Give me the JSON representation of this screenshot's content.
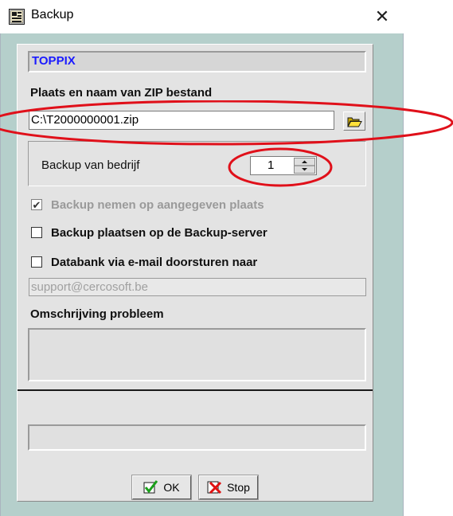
{
  "window": {
    "title": "Backup"
  },
  "company": "TOPPIX",
  "zip": {
    "label": "Plaats en naam van ZIP bestand",
    "value": "C:\\T2000000001.zip"
  },
  "bedrijf": {
    "label": "Backup van bedrijf",
    "value": "1"
  },
  "options": {
    "local": {
      "label": "Backup nemen op aangegeven plaats",
      "checked": true,
      "disabled": true
    },
    "server": {
      "label": "Backup plaatsen op de Backup-server",
      "checked": false
    },
    "email": {
      "label": "Databank via e-mail doorsturen naar",
      "checked": false
    }
  },
  "email_value": "support@cercosoft.be",
  "omschrijving_label": "Omschrijving probleem",
  "buttons": {
    "ok": "OK",
    "stop": "Stop"
  },
  "colors": {
    "dialog_bg": "#b5cfcb",
    "panel_bg": "#e3e3e3",
    "company_text": "#1a1aff",
    "annotation": "#e0101a"
  },
  "icons": [
    "app-icon",
    "close-icon",
    "folder-icon",
    "spin-up-icon",
    "spin-down-icon",
    "ok-check-icon",
    "stop-x-icon"
  ]
}
